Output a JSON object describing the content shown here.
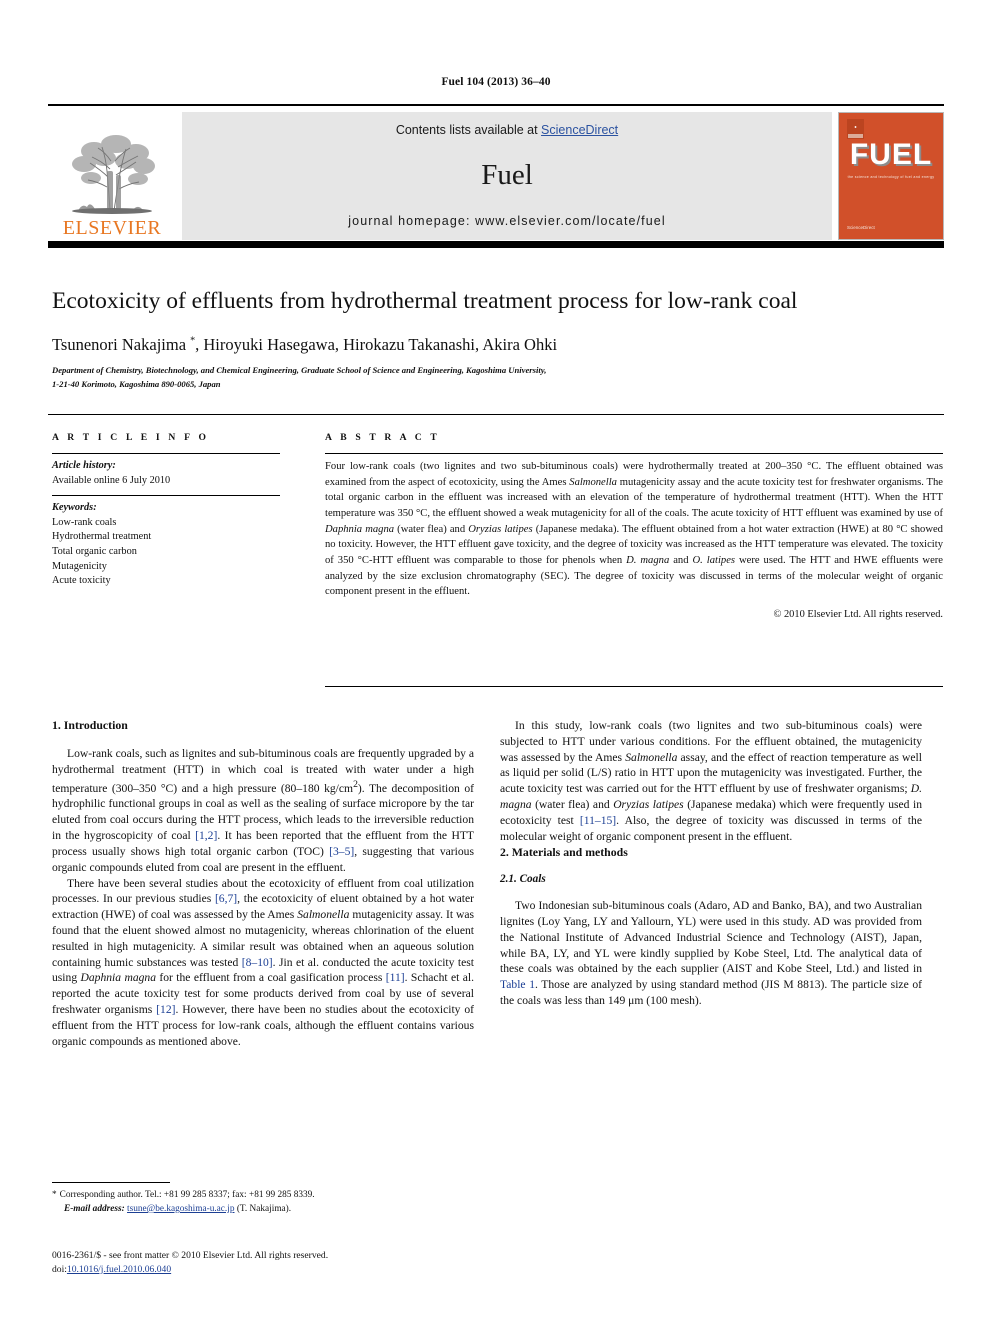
{
  "running_head": "Fuel 104 (2013) 36–40",
  "masthead": {
    "publisher_name": "ELSEVIER",
    "contents_prefix": "Contents lists available at ",
    "contents_link": "ScienceDirect",
    "journal_name": "Fuel",
    "homepage": "journal homepage: www.elsevier.com/locate/fuel",
    "cover": {
      "wordmark": "FUEL",
      "tagline": "the science and technology of fuel and energy",
      "footer": "ScienceDirect"
    }
  },
  "article": {
    "title": "Ecotoxicity of effluents from hydrothermal treatment process for low-rank coal",
    "authors": "Tsunenori Nakajima , Hiroyuki Hasegawa, Hirokazu Takanashi, Akira Ohki",
    "corresponding_marker": "*",
    "affiliation_line1": "Department of Chemistry, Biotechnology, and Chemical Engineering, Graduate School of Science and Engineering, Kagoshima University,",
    "affiliation_line2": "1-21-40 Korimoto, Kagoshima 890-0065, Japan"
  },
  "article_info": {
    "heading": "A R T I C L E   I N F O",
    "history_label": "Article history:",
    "history_value": "Available online 6 July 2010",
    "keywords_label": "Keywords:",
    "keywords": [
      "Low-rank coals",
      "Hydrothermal treatment",
      "Total organic carbon",
      "Mutagenicity",
      "Acute toxicity"
    ]
  },
  "abstract": {
    "heading": "A B S T R A C T",
    "text": "Four low-rank coals (two lignites and two sub-bituminous coals) were hydrothermally treated at 200–350 °C. The effluent obtained was examined from the aspect of ecotoxicity, using the Ames Salmonella mutagenicity assay and the acute toxicity test for freshwater organisms. The total organic carbon in the effluent was increased with an elevation of the temperature of hydrothermal treatment (HTT). When the HTT temperature was 350 °C, the effluent showed a weak mutagenicity for all of the coals. The acute toxicity of HTT effluent was examined by use of Daphnia magna (water flea) and Oryzias latipes (Japanese medaka). The effluent obtained from a hot water extraction (HWE) at 80 °C showed no toxicity. However, the HTT effluent gave toxicity, and the degree of toxicity was increased as the HTT temperature was elevated. The toxicity of 350 °C-HTT effluent was comparable to those for phenols when D. magna and O. latipes were used. The HTT and HWE effluents were analyzed by the size exclusion chromatography (SEC). The degree of toxicity was discussed in terms of the molecular weight of organic component present in the effluent.",
    "copyright": "© 2010 Elsevier Ltd. All rights reserved."
  },
  "body": {
    "intro_heading": "1. Introduction",
    "intro_p1": "Low-rank coals, such as lignites and sub-bituminous coals are frequently upgraded by a hydrothermal treatment (HTT) in which coal is treated with water under a high temperature (300–350 °C) and a high pressure (80–180 kg/cm2). The decomposition of hydrophilic functional groups in coal as well as the sealing of surface micropore by the tar eluted from coal occurs during the HTT process, which leads to the irreversible reduction in the hygroscopicity of coal [1,2]. It has been reported that the effluent from the HTT process usually shows high total organic carbon (TOC) [3–5], suggesting that various organic compounds eluted from coal are present in the effluent.",
    "intro_p2": "There have been several studies about the ecotoxicity of effluent from coal utilization processes. In our previous studies [6,7], the ecotoxicity of eluent obtained by a hot water extraction (HWE) of coal was assessed by the Ames Salmonella mutagenicity assay. It was found that the eluent showed almost no mutagenicity, whereas chlorination of the eluent resulted in high mutagenicity. A similar result was obtained when an aqueous solution containing humic substances was tested [8–10]. Jin et al. conducted the acute toxicity test using Daphnia magna for the effluent from a coal gasification process [11]. Schacht et al. reported the acute toxicity test for some products derived from coal by use of several freshwater organisms [12]. However, there have been no studies about the ecotoxicity of effluent from the HTT process for low-rank coals, although the effluent contains various organic compounds as mentioned above.",
    "intro_p3": "In this study, low-rank coals (two lignites and two sub-bituminous coals) were subjected to HTT under various conditions. For the effluent obtained, the mutagenicity was assessed by the Ames Salmonella assay, and the effect of reaction temperature as well as liquid per solid (L/S) ratio in HTT upon the mutagenicity was investigated. Further, the acute toxicity test was carried out for the HTT effluent by use of freshwater organisms; D. magna (water flea) and Oryzias latipes (Japanese medaka) which were frequently used in ecotoxicity test [11–15]. Also, the degree of toxicity was discussed in terms of the molecular weight of organic component present in the effluent.",
    "materials_heading": "2. Materials and methods",
    "coals_heading": "2.1. Coals",
    "coals_p1": "Two Indonesian sub-bituminous coals (Adaro, AD and Banko, BA), and two Australian lignites (Loy Yang, LY and Yallourn, YL) were used in this study. AD was provided from the National Institute of Advanced Industrial Science and Technology (AIST), Japan, while BA, LY, and YL were kindly supplied by Kobe Steel, Ltd. The analytical data of these coals was obtained by the each supplier (AIST and Kobe Steel, Ltd.) and listed in Table 1. Those are analyzed by using standard method (JIS M 8813). The particle size of the coals was less than 149 μm (100 mesh)."
  },
  "footnote": {
    "marker": "*",
    "corresponding": "Corresponding author. Tel.: +81 99 285 8337; fax: +81 99 285 8339.",
    "email_label": "E-mail address:",
    "email": "tsune@be.kagoshima-u.ac.jp",
    "email_suffix": "(T. Nakajima)."
  },
  "imprint": {
    "issn_line": "0016-2361/$ - see front matter © 2010 Elsevier Ltd. All rights reserved.",
    "doi_label": "doi:",
    "doi_value": "10.1016/j.fuel.2010.06.040"
  },
  "colors": {
    "link": "#1c3f94",
    "elsevier_orange": "#E87722",
    "cover_orange": "#D1502A",
    "band_gray": "#e6e6e6"
  }
}
